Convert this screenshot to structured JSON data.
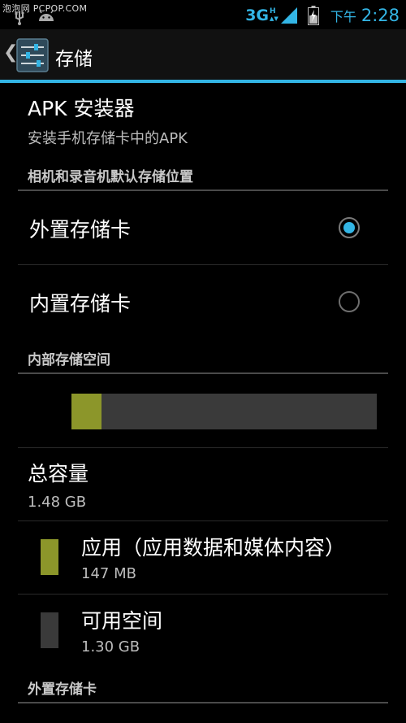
{
  "status_bar": {
    "watermark": "泡泡网 PCPOP.COM",
    "network": "3G",
    "network_sub": "H",
    "ampm": "下午",
    "time": "2:28",
    "accent": "#33b5e5"
  },
  "action_bar": {
    "back_icon": "chevron-left-icon",
    "app_icon": "settings-sliders-icon",
    "title": "存储"
  },
  "apk_installer": {
    "title": "APK 安装器",
    "summary": "安装手机存储卡中的APK"
  },
  "default_location": {
    "header": "相机和录音机默认存储位置",
    "options": [
      {
        "label": "外置存储卡",
        "selected": true
      },
      {
        "label": "内置存储卡",
        "selected": false
      }
    ]
  },
  "internal_storage": {
    "header": "内部存储空间",
    "usage_fraction": 0.099,
    "total_label": "总容量",
    "total_value": "1.48 GB",
    "items": [
      {
        "label": "应用（应用数据和媒体内容）",
        "value": "147 MB",
        "color": "#8c962a"
      },
      {
        "label": "可用空间",
        "value": "1.30 GB",
        "color": "#3a3a3a"
      }
    ]
  },
  "external_storage": {
    "header": "外置存储卡"
  }
}
